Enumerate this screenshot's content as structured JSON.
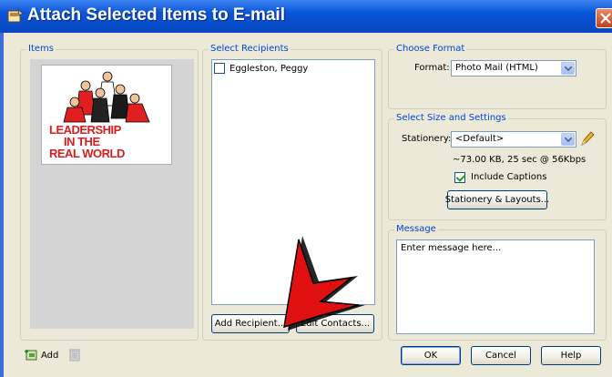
{
  "window": {
    "title": "Attach Selected Items to E-mail"
  },
  "items_panel": {
    "legend": "Items",
    "thumbnail_text": [
      "LEADERSHIP",
      "IN THE",
      "REAL WORLD"
    ]
  },
  "recipients_panel": {
    "legend": "Select Recipients",
    "recipients": [
      {
        "name": "Eggleston, Peggy",
        "checked": false
      }
    ],
    "add_recipient_label": "Add Recipient...",
    "edit_contacts_label": "Edit Contacts..."
  },
  "format_panel": {
    "legend": "Choose Format",
    "format_label": "Format:",
    "format_value": "Photo Mail (HTML)"
  },
  "size_panel": {
    "legend": "Select Size and Settings",
    "stationery_label": "Stationery:",
    "stationery_value": "<Default>",
    "size_info": "~73.00 KB, 25 sec @ 56Kbps",
    "include_captions_label": "Include Captions",
    "include_captions_checked": true,
    "stationery_layouts_label": "Stationery & Layouts..."
  },
  "message_panel": {
    "legend": "Message",
    "placeholder": "Enter message here..."
  },
  "footer": {
    "add_label": "Add",
    "ok_label": "OK",
    "cancel_label": "Cancel",
    "help_label": "Help"
  },
  "colors": {
    "titlebar": "#0a55d8",
    "dialog_bg": "#ece9d8",
    "legend_text": "#0046d5",
    "pointer": "#e01010"
  }
}
